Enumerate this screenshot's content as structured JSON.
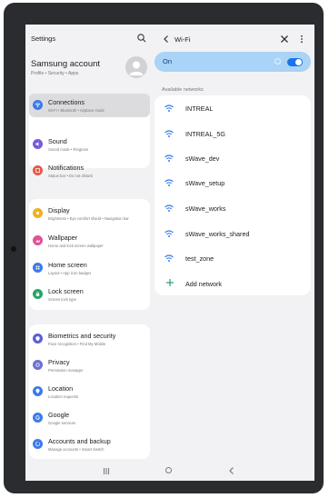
{
  "left_pane": {
    "title": "Settings",
    "account": {
      "name": "Samsung account",
      "subtitle": "Profile  •  Security  •  Apps"
    },
    "groups": [
      {
        "items": [
          {
            "label": "Connections",
            "subtitle": "Wi-Fi  •  Bluetooth  •  Airplane mode",
            "icon": "wifi-icon",
            "color": "#3b7bea",
            "selected": true
          },
          {
            "label": "Sound",
            "subtitle": "Sound mode  •  Ringtone",
            "icon": "sound-icon",
            "color": "#7a5bd6"
          },
          {
            "label": "Notifications",
            "subtitle": "Status bar  •  Do not disturb",
            "icon": "notification-icon",
            "color": "#e4594b"
          }
        ]
      },
      {
        "items": [
          {
            "label": "Display",
            "subtitle": "Brightness  •  Eye comfort shield  •  Navigation bar",
            "icon": "display-icon",
            "color": "#f2b01e"
          },
          {
            "label": "Wallpaper",
            "subtitle": "Home and lock screen wallpaper",
            "icon": "wallpaper-icon",
            "color": "#e05494"
          },
          {
            "label": "Home screen",
            "subtitle": "Layout  •  App icon badges",
            "icon": "home-screen-icon",
            "color": "#3b7bea"
          },
          {
            "label": "Lock screen",
            "subtitle": "Screen lock type",
            "icon": "lock-icon",
            "color": "#27a567"
          }
        ]
      },
      {
        "items": [
          {
            "label": "Biometrics and security",
            "subtitle": "Face recognition  •  Find My Mobile",
            "icon": "shield-icon",
            "color": "#5a5fd6"
          },
          {
            "label": "Privacy",
            "subtitle": "Permission manager",
            "icon": "privacy-icon",
            "color": "#6f6fd6"
          },
          {
            "label": "Location",
            "subtitle": "Location requests",
            "icon": "location-icon",
            "color": "#3b7bea"
          },
          {
            "label": "Google",
            "subtitle": "Google services",
            "icon": "google-icon",
            "color": "#3b7bea"
          },
          {
            "label": "Accounts and backup",
            "subtitle": "Manage accounts  •  Smart Switch",
            "icon": "accounts-icon",
            "color": "#3b7bea"
          }
        ]
      }
    ]
  },
  "right_pane": {
    "title": "Wi-Fi",
    "toggle_label": "On",
    "toggle_on": true,
    "section_label": "Available networks",
    "networks": [
      "INTREAL",
      "INTREAL_5G",
      "sWave_dev",
      "sWave_setup",
      "sWave_works",
      "sWave_works_shared",
      "test_zone"
    ],
    "add_network": "Add network",
    "accent_color": "#1a73e8"
  }
}
